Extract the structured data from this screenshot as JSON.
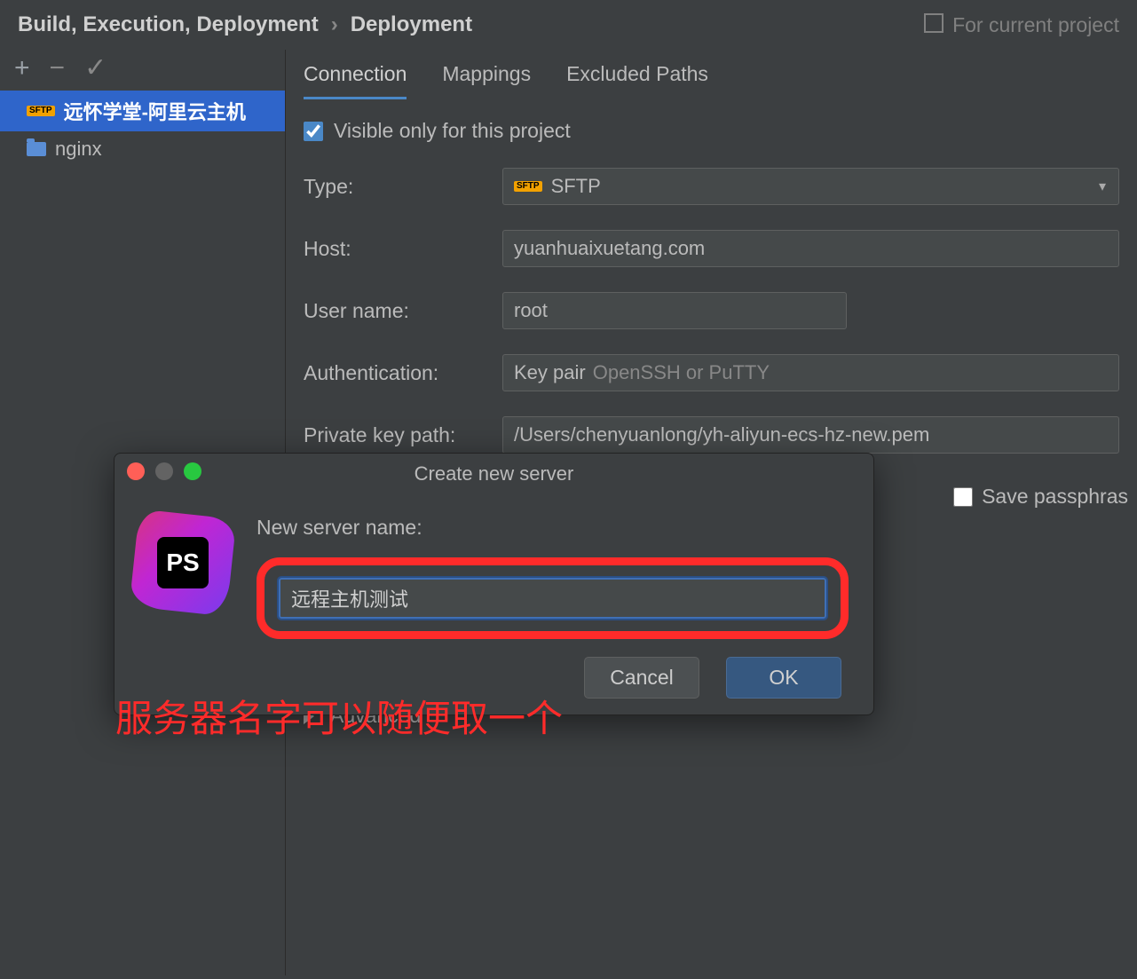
{
  "breadcrumb": {
    "parent": "Build, Execution, Deployment",
    "current": "Deployment"
  },
  "for_project_hint": "For current project",
  "toolbar": {
    "add": "+",
    "remove": "−",
    "check": "✓"
  },
  "servers": [
    {
      "name": "远怀学堂-阿里云主机",
      "kind": "sftp",
      "selected": true
    },
    {
      "name": "nginx",
      "kind": "folder",
      "selected": false
    }
  ],
  "tabs": [
    {
      "label": "Connection",
      "active": true
    },
    {
      "label": "Mappings",
      "active": false
    },
    {
      "label": "Excluded Paths",
      "active": false
    }
  ],
  "form": {
    "visible_only_label": "Visible only for this project",
    "visible_only_checked": true,
    "type_label": "Type:",
    "type_value": "SFTP",
    "host_label": "Host:",
    "host_value": "yuanhuaixuetang.com",
    "user_label": "User name:",
    "user_value": "root",
    "auth_label": "Authentication:",
    "auth_value": "Key pair",
    "auth_hint": "OpenSSH or PuTTY",
    "pk_label": "Private key path:",
    "pk_value": "/Users/chenyuanlong/yh-aliyun-ecs-hz-new.pem",
    "save_pass_label": "Save passphras",
    "advanced_label": "Advanced"
  },
  "dialog": {
    "title": "Create new server",
    "logo_text": "PS",
    "field_label": "New server name:",
    "field_value": "远程主机测试",
    "cancel": "Cancel",
    "ok": "OK"
  },
  "annotation": "服务器名字可以随便取一个"
}
